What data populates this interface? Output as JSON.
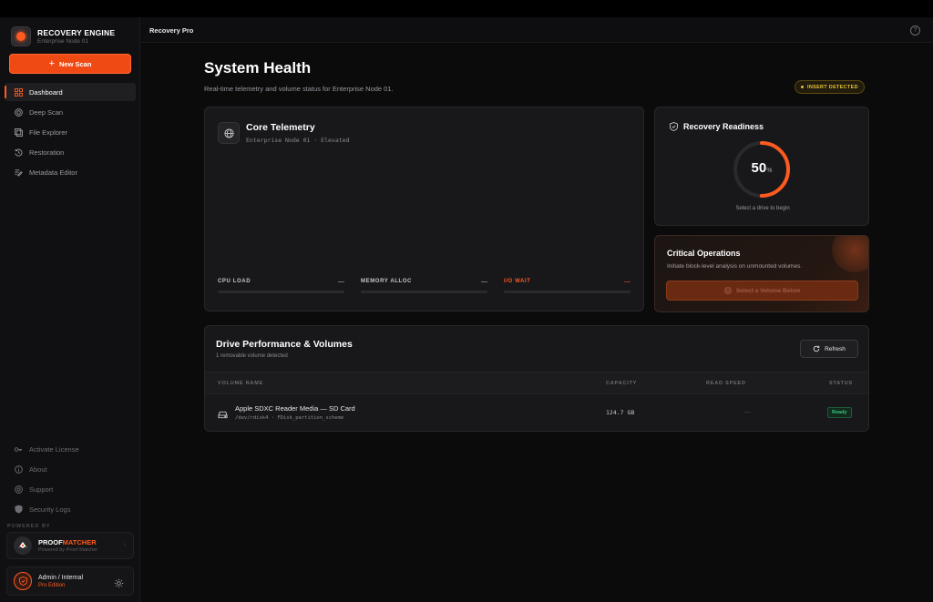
{
  "brand": {
    "title": "RECOVERY ENGINE",
    "subtitle": "Enterprise Node 01"
  },
  "new_scan_label": "New Scan",
  "nav": [
    {
      "label": "Dashboard",
      "icon": "grid-icon",
      "active": true
    },
    {
      "label": "Deep Scan",
      "icon": "target-icon"
    },
    {
      "label": "File Explorer",
      "icon": "folder-icon"
    },
    {
      "label": "Restoration",
      "icon": "history-icon"
    },
    {
      "label": "Metadata Editor",
      "icon": "edit-list-icon"
    }
  ],
  "nav_bottom": [
    {
      "label": "Activate License",
      "icon": "key-icon"
    },
    {
      "label": "About",
      "icon": "info-icon"
    },
    {
      "label": "Support",
      "icon": "help-icon"
    },
    {
      "label": "Security Logs",
      "icon": "shield-icon"
    }
  ],
  "powered_by": "POWERED BY",
  "proofmatcher": {
    "title_a": "PROOF",
    "title_b": "MATCHER",
    "subtitle": "Powered by Proof Matcher"
  },
  "user": {
    "name": "Admin / Internal",
    "edition": "Pro Edition"
  },
  "header": {
    "app_title": "Recovery Pro"
  },
  "page": {
    "title": "System Health",
    "subtitle": "Real-time telemetry and volume status for Enterprise Node 01.",
    "badge": "INSERT DETECTED"
  },
  "telemetry": {
    "title": "Core Telemetry",
    "subtitle": "Enterprise Node 01 · Elevated",
    "metrics": [
      {
        "label": "CPU LOAD",
        "value": "—"
      },
      {
        "label": "MEMORY ALLOC",
        "value": "—"
      },
      {
        "label": "I/O WAIT",
        "value": "—"
      }
    ]
  },
  "readiness": {
    "title": "Recovery Readiness",
    "value": "50",
    "unit": "%",
    "fraction": 0.5,
    "hint": "Select a drive to begin"
  },
  "critical": {
    "title": "Critical Operations",
    "subtitle": "Initiate block-level analysis on unmounted volumes.",
    "button": "Select a Volume Below"
  },
  "drives": {
    "title": "Drive Performance & Volumes",
    "subtitle": "1 removable volume detected",
    "refresh_label": "Refresh",
    "columns": [
      "VOLUME NAME",
      "CAPACITY",
      "READ SPEED",
      "STATUS"
    ],
    "rows": [
      {
        "name": "Apple SDXC Reader Media — SD Card",
        "path": "/dev/rdisk4 · FDisk_partition_scheme",
        "capacity": "124.7 GB",
        "read_speed": "—",
        "status": "Ready"
      }
    ]
  },
  "colors": {
    "accent": "#ff5a1f",
    "ready": "#3cc47a",
    "warning": "#e6c23a"
  }
}
